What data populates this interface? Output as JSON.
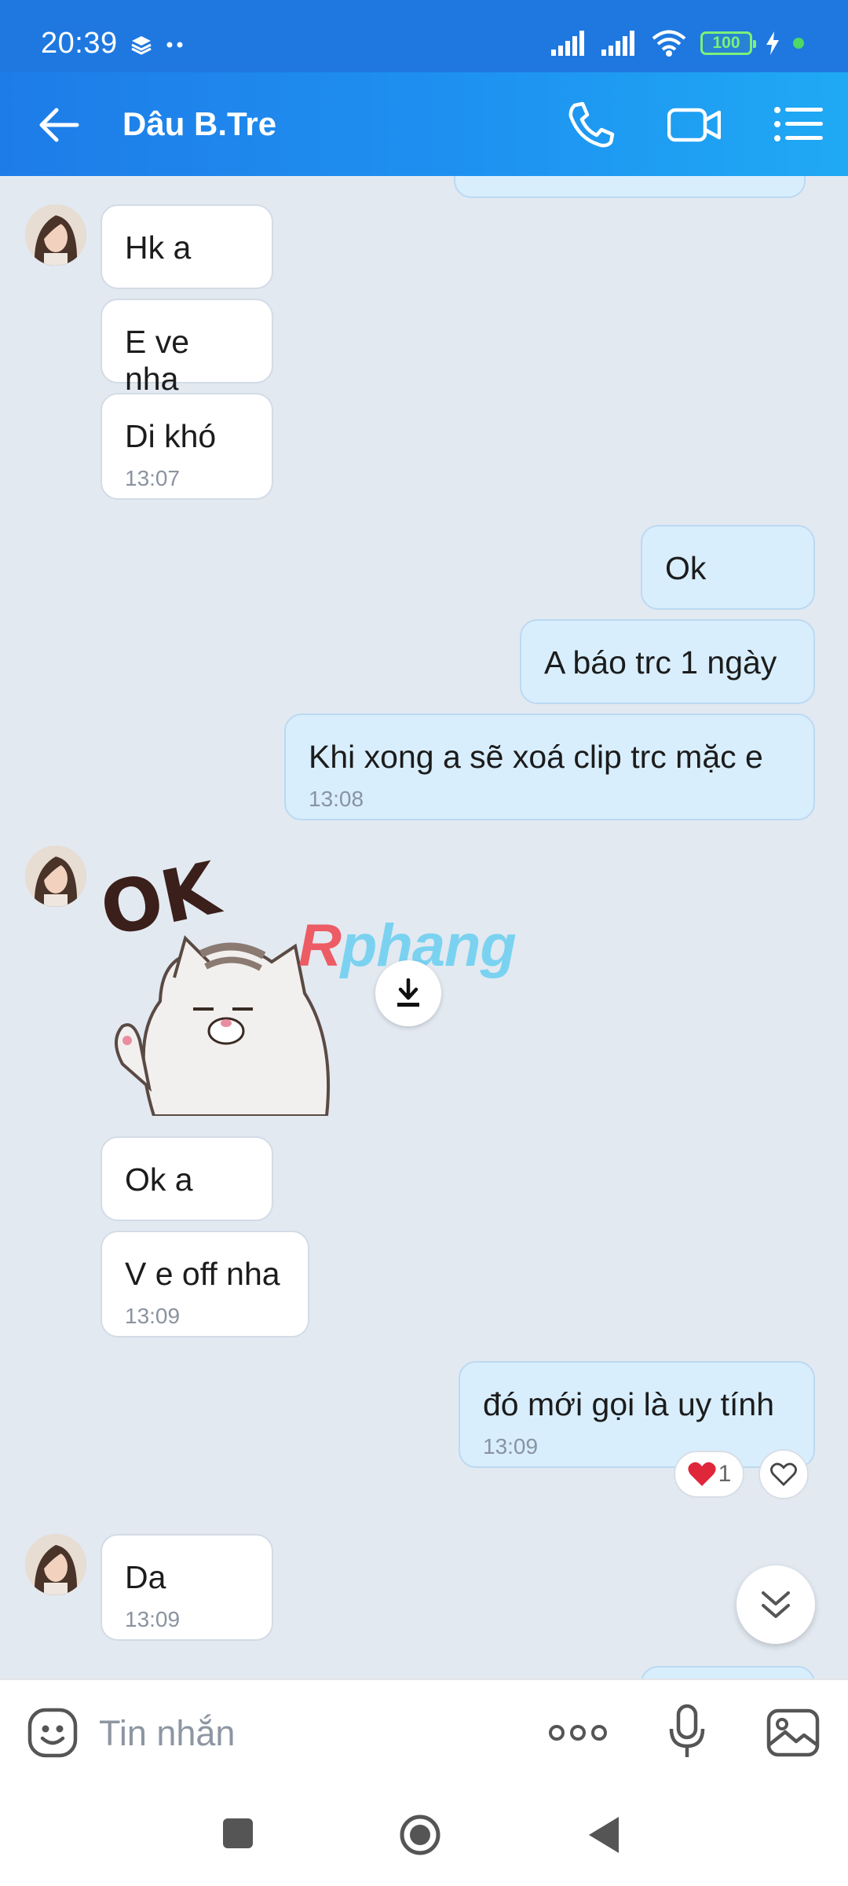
{
  "status_bar": {
    "time": "20:39",
    "battery": "100",
    "icons": [
      "layers-icon",
      "dots-icon",
      "signal-icon",
      "signal-icon",
      "wifi-icon",
      "battery-icon",
      "charging-icon"
    ]
  },
  "header": {
    "title": "Dâu B.Tre",
    "icons": [
      "back-arrow-icon",
      "phone-icon",
      "video-call-icon",
      "menu-list-icon"
    ]
  },
  "messages": [
    {
      "side": "in",
      "text": "Hk a"
    },
    {
      "side": "in",
      "text": "E ve nha"
    },
    {
      "side": "in",
      "text": "Di khó",
      "time": "13:07"
    },
    {
      "side": "out",
      "text": "Ok"
    },
    {
      "side": "out",
      "text": "A báo trc 1 ngày"
    },
    {
      "side": "out",
      "text": "Khi xong a sẽ xoá clip trc mặc e",
      "time": "13:08"
    },
    {
      "side": "in",
      "type": "sticker",
      "sticker_text": "OK"
    },
    {
      "side": "in",
      "text": "Ok a"
    },
    {
      "side": "in",
      "text": "V e off nha",
      "time": "13:09"
    },
    {
      "side": "out",
      "text": "đó mới gọi là uy tính",
      "time": "13:09",
      "reaction_count": "1"
    },
    {
      "side": "in",
      "text": "Da",
      "time": "13:09"
    }
  ],
  "watermark": {
    "first": "R",
    "rest": "phang"
  },
  "composer": {
    "placeholder": "Tin nhắn",
    "icons": [
      "emoji-icon",
      "more-options-icon",
      "microphone-icon",
      "gallery-icon"
    ]
  },
  "colors": {
    "header_start": "#1e7ce8",
    "header_end": "#1fa9f4",
    "background": "#e2e9f1",
    "outgoing_bubble": "#d8eefd",
    "incoming_bubble": "#ffffff"
  }
}
